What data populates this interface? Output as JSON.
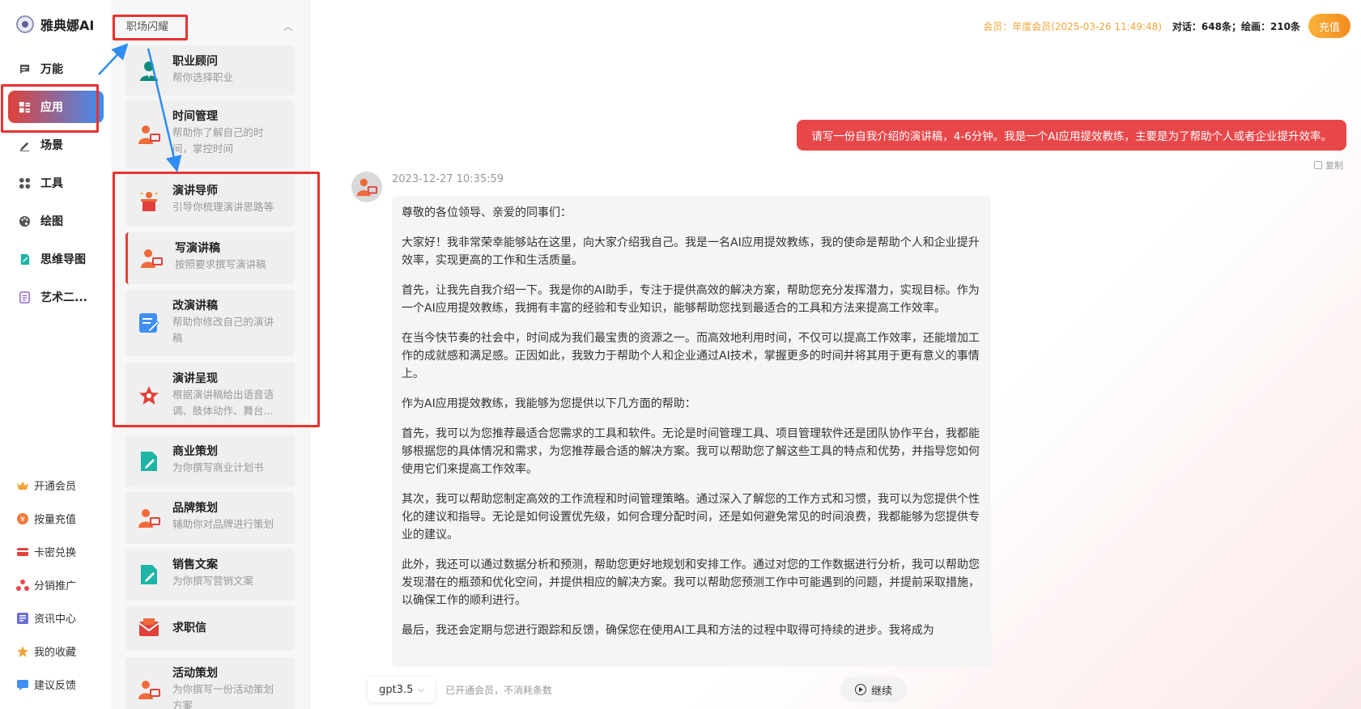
{
  "brand": {
    "name": "雅典娜AI"
  },
  "nav": {
    "items": [
      {
        "label": "万能",
        "icon": "chat-icon"
      },
      {
        "label": "应用",
        "icon": "apps-grid-icon",
        "active": true
      },
      {
        "label": "场景",
        "icon": "pen-icon"
      },
      {
        "label": "工具",
        "icon": "tools-icon"
      },
      {
        "label": "绘图",
        "icon": "palette-icon"
      },
      {
        "label": "思维导图",
        "icon": "mindmap-icon"
      },
      {
        "label": "艺术二...",
        "icon": "art-icon"
      }
    ],
    "bottom": [
      {
        "label": "开通会员",
        "icon": "crown-icon",
        "color": "#f0a53a"
      },
      {
        "label": "按量充值",
        "icon": "coin-icon",
        "color": "#f07a3a"
      },
      {
        "label": "卡密兑换",
        "icon": "card-icon",
        "color": "#e0413a"
      },
      {
        "label": "分销推广",
        "icon": "share-icon",
        "color": "#e8474a"
      },
      {
        "label": "资讯中心",
        "icon": "news-icon",
        "color": "#6a6fd6"
      },
      {
        "label": "我的收藏",
        "icon": "star-icon",
        "color": "#f0a53a"
      },
      {
        "label": "建议反馈",
        "icon": "feedback-icon",
        "color": "#3f8ef3"
      }
    ]
  },
  "apps": {
    "category": "职场闪耀",
    "cards": [
      {
        "title": "职业顾问",
        "desc1": "帮你选择职业",
        "desc2": ""
      },
      {
        "title": "时间管理",
        "desc1": "帮助你了解自己的时",
        "desc2": "间，掌控时间"
      },
      {
        "title": "演讲导师",
        "desc1": "引导你梳理演讲思路等",
        "desc2": ""
      },
      {
        "title": "写演讲稿",
        "desc1": "按照要求撰写演讲稿",
        "desc2": ""
      },
      {
        "title": "改演讲稿",
        "desc1": "帮助你修改自己的演讲",
        "desc2": "稿"
      },
      {
        "title": "演讲呈现",
        "desc1": "根据演讲稿给出语音语",
        "desc2": "调、肢体动作、舞台..."
      },
      {
        "title": "商业策划",
        "desc1": "为你撰写商业计划书",
        "desc2": ""
      },
      {
        "title": "品牌策划",
        "desc1": "辅助你对品牌进行策划",
        "desc2": ""
      },
      {
        "title": "销售文案",
        "desc1": "为你撰写营销文案",
        "desc2": ""
      },
      {
        "title": "求职信",
        "desc1": "",
        "desc2": ""
      },
      {
        "title": "活动策划",
        "desc1": "为你撰写一份活动策划",
        "desc2": "方案"
      }
    ]
  },
  "topbar": {
    "member": "会员：年度会员(2025-03-26 11:49:48)",
    "usage": "对话：648条；绘画：210条",
    "recharge": "充值"
  },
  "chat": {
    "user_message": "请写一份自我介绍的演讲稿，4-6分钟。我是一个AI应用提效教练，主要是为了帮助个人或者企业提升效率。",
    "copy_label": "复制",
    "timestamp": "2023-12-27 10:35:59",
    "answer": [
      "尊敬的各位领导、亲爱的同事们：",
      "大家好！我非常荣幸能够站在这里，向大家介绍我自己。我是一名AI应用提效教练，我的使命是帮助个人和企业提升效率，实现更高的工作和生活质量。",
      "首先，让我先自我介绍一下。我是你的AI助手，专注于提供高效的解决方案，帮助您充分发挥潜力，实现目标。作为一个AI应用提效教练，我拥有丰富的经验和专业知识，能够帮助您找到最适合的工具和方法来提高工作效率。",
      "在当今快节奏的社会中，时间成为我们最宝贵的资源之一。而高效地利用时间，不仅可以提高工作效率，还能增加工作的成就感和满足感。正因如此，我致力于帮助个人和企业通过AI技术，掌握更多的时间并将其用于更有意义的事情上。",
      "作为AI应用提效教练，我能够为您提供以下几方面的帮助：",
      "首先，我可以为您推荐最适合您需求的工具和软件。无论是时间管理工具、项目管理软件还是团队协作平台，我都能够根据您的具体情况和需求，为您推荐最合适的解决方案。我可以帮助您了解这些工具的特点和优势，并指导您如何使用它们来提高工作效率。",
      "其次，我可以帮助您制定高效的工作流程和时间管理策略。通过深入了解您的工作方式和习惯，我可以为您提供个性化的建议和指导。无论是如何设置优先级，如何合理分配时间，还是如何避免常见的时间浪费，我都能够为您提供专业的建议。",
      "此外，我还可以通过数据分析和预测，帮助您更好地规划和安排工作。通过对您的工作数据进行分析，我可以帮助您发现潜在的瓶颈和优化空间，并提供相应的解决方案。我可以帮助您预测工作中可能遇到的问题，并提前采取措施，以确保工作的顺利进行。",
      "最后，我还会定期与您进行跟踪和反馈，确保您在使用AI工具和方法的过程中取得可持续的进步。我将成为"
    ]
  },
  "footer": {
    "model": "gpt3.5",
    "note": "已开通会员，不消耗条数",
    "continue": "继续"
  },
  "colors": {
    "accent_red": "#e8474a",
    "accent_orange": "#f38a1f",
    "annotation_red": "#e8332f",
    "annotation_blue": "#2f8cf0"
  }
}
